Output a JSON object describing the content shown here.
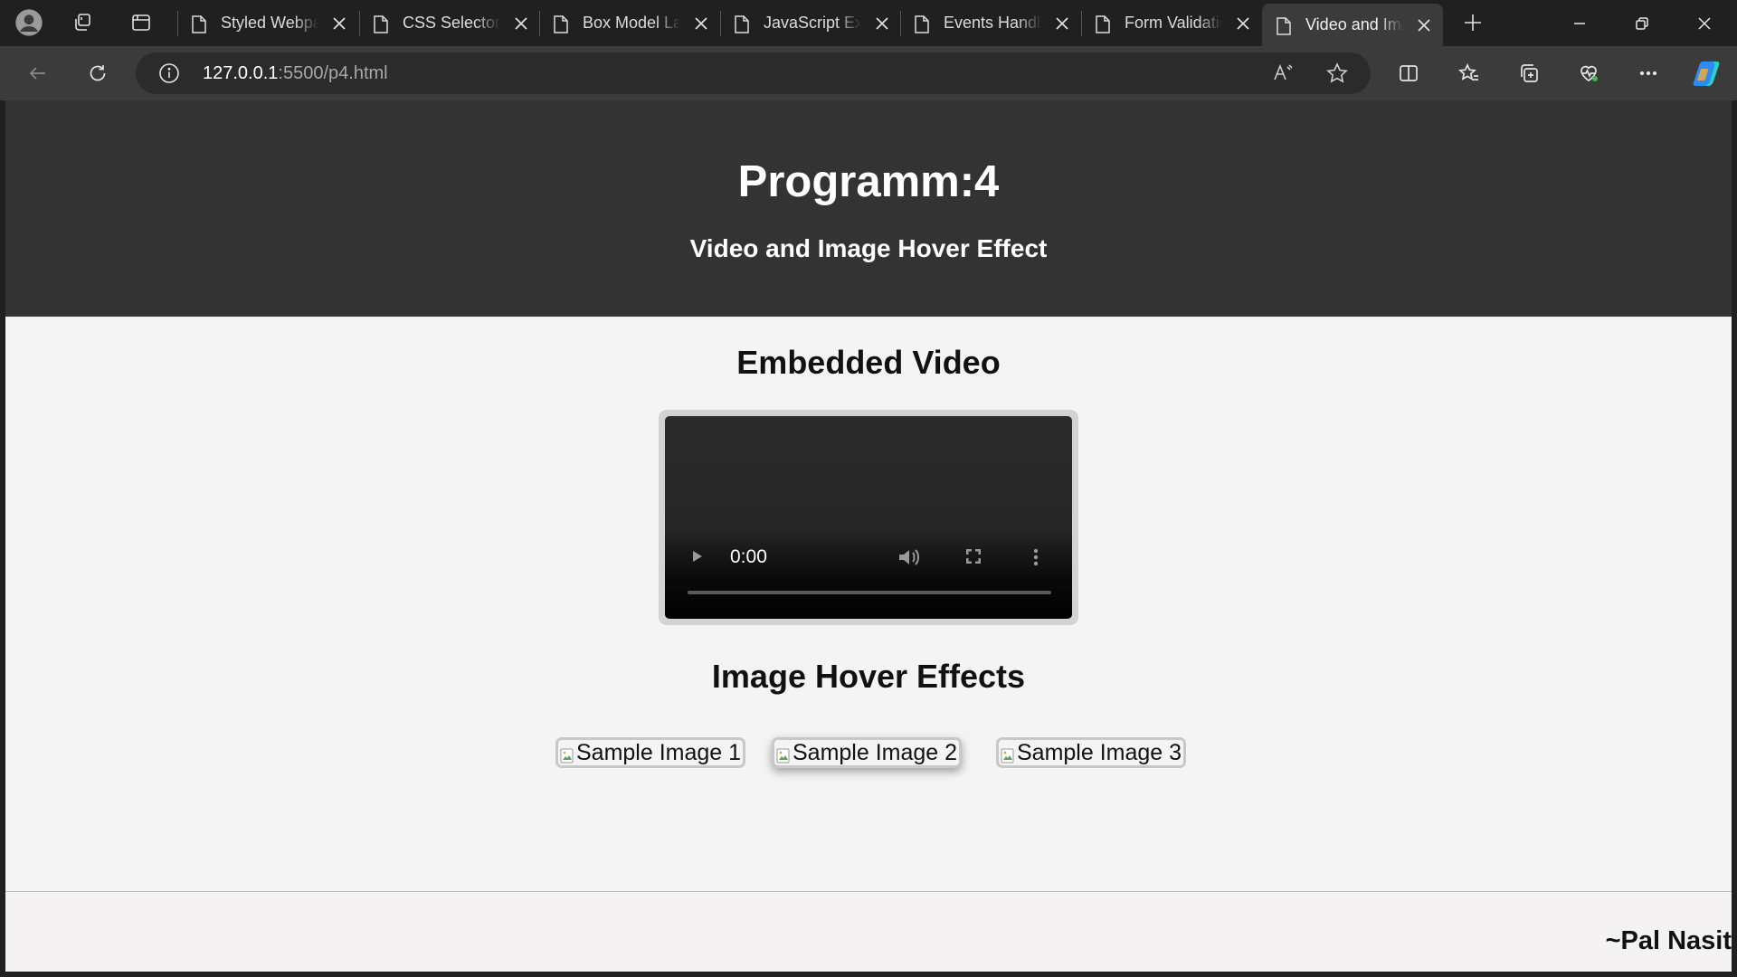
{
  "browser": {
    "tabs": [
      {
        "title": "Styled Webpage"
      },
      {
        "title": "CSS Selectors"
      },
      {
        "title": "Box Model Layout"
      },
      {
        "title": "JavaScript Examples"
      },
      {
        "title": "Events Handling"
      },
      {
        "title": "Form Validation"
      },
      {
        "title": "Video and Image"
      }
    ],
    "url_host": "127.0.0.1",
    "url_path": ":5500/p4.html"
  },
  "page": {
    "title": "Programm:4",
    "subtitle": "Video and Image Hover Effect",
    "video_heading": "Embedded Video",
    "video_time": "0:00",
    "images_heading": "Image Hover Effects",
    "images": [
      {
        "alt": "Sample Image 1"
      },
      {
        "alt": "Sample Image 2"
      },
      {
        "alt": "Sample Image 3"
      }
    ],
    "footer": "~Pal Nasit"
  },
  "colors": {
    "header_bg": "#333333",
    "page_bg": "#f4f4f4",
    "chrome_bg": "#202020",
    "toolbar_bg": "#3b3b3b"
  }
}
